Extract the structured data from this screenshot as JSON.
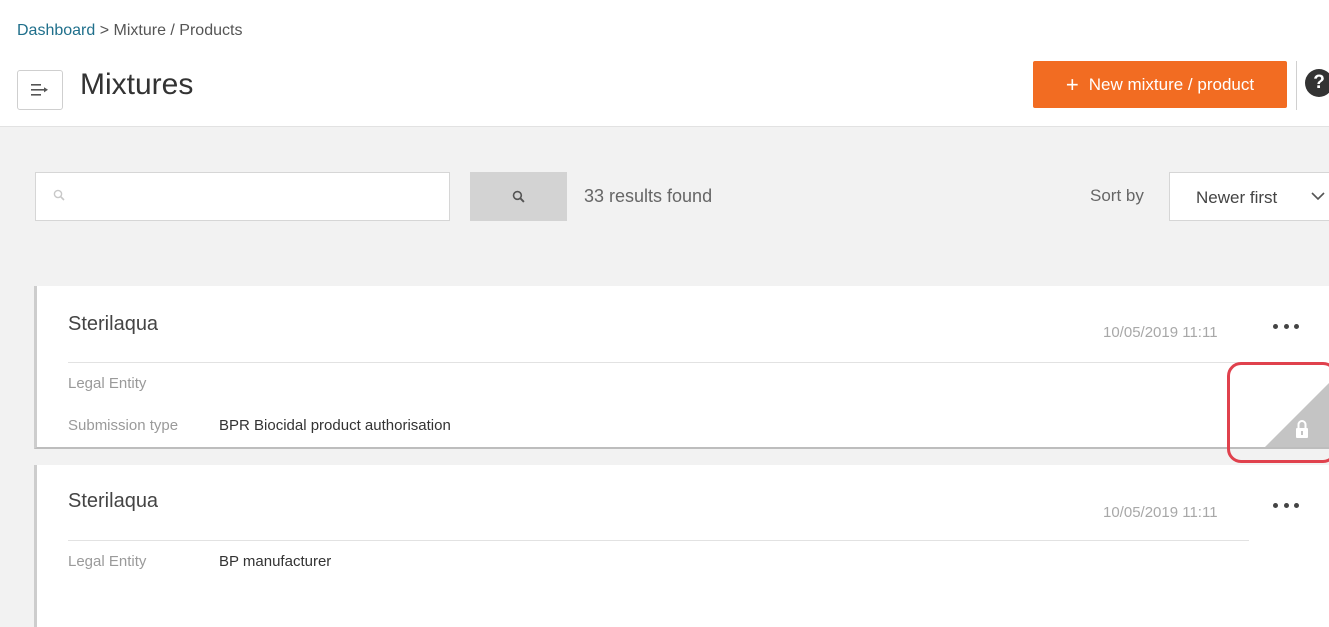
{
  "breadcrumb": {
    "home": "Dashboard",
    "separator": " > ",
    "current": "Mixture / Products"
  },
  "header": {
    "title": "Mixtures",
    "menu_icon": "menu-toggle-icon",
    "new_button_label": "New mixture / product",
    "new_button_icon": "plus-icon",
    "help_label": "?"
  },
  "search": {
    "placeholder": "",
    "value": "",
    "results_text": "33 results found"
  },
  "sort": {
    "label": "Sort by",
    "selected": "Newer first"
  },
  "cards": [
    {
      "title": "Sterilaqua",
      "date": "10/05/2019 11:11",
      "fields": [
        {
          "label": "Legal Entity",
          "value": ""
        },
        {
          "label": "Submission type",
          "value": "BPR Biocidal product authorisation"
        }
      ],
      "locked": true
    },
    {
      "title": "Sterilaqua",
      "date": "10/05/2019 11:11",
      "fields": [
        {
          "label": "Legal Entity",
          "value": "BP manufacturer"
        }
      ],
      "locked": false
    }
  ],
  "colors": {
    "accent": "#f26c22",
    "link": "#1f6f8b",
    "highlight": "#e0414d",
    "lock_corner": "#c4c4c4"
  }
}
